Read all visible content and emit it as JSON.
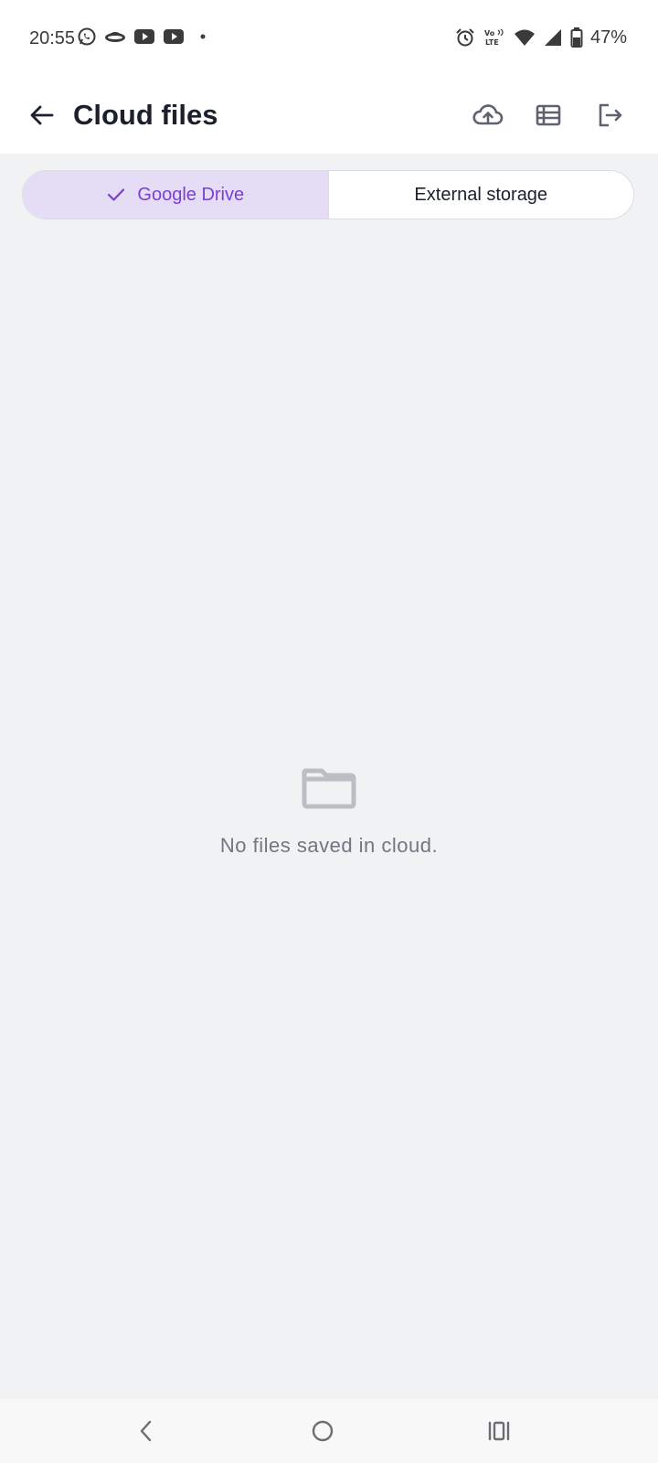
{
  "status_bar": {
    "time": "20:55",
    "battery": "47%",
    "left_icons": [
      "whatsapp-icon",
      "hat-icon",
      "youtube-icon",
      "youtube-icon",
      "dot-icon"
    ],
    "right_icons": [
      "alarm-icon",
      "volte-icon",
      "wifi-icon",
      "signal-icon",
      "battery-icon"
    ]
  },
  "app_bar": {
    "title": "Cloud files",
    "actions": [
      "cloud-upload-icon",
      "list-view-icon",
      "logout-icon"
    ]
  },
  "tabs": [
    {
      "label": "Google Drive",
      "selected": true
    },
    {
      "label": "External storage",
      "selected": false
    }
  ],
  "empty_state": {
    "message": "No files saved in cloud.",
    "icon": "folder-icon"
  },
  "colors": {
    "accent": "#7a3fd6",
    "selected_tab_bg": "#e5ddf6",
    "background": "#f1f2f4",
    "title": "#1b1f2e",
    "muted_text": "#737682"
  },
  "nav_bar": {
    "buttons": [
      "back-nav-icon",
      "home-nav-icon",
      "recents-nav-icon"
    ]
  }
}
